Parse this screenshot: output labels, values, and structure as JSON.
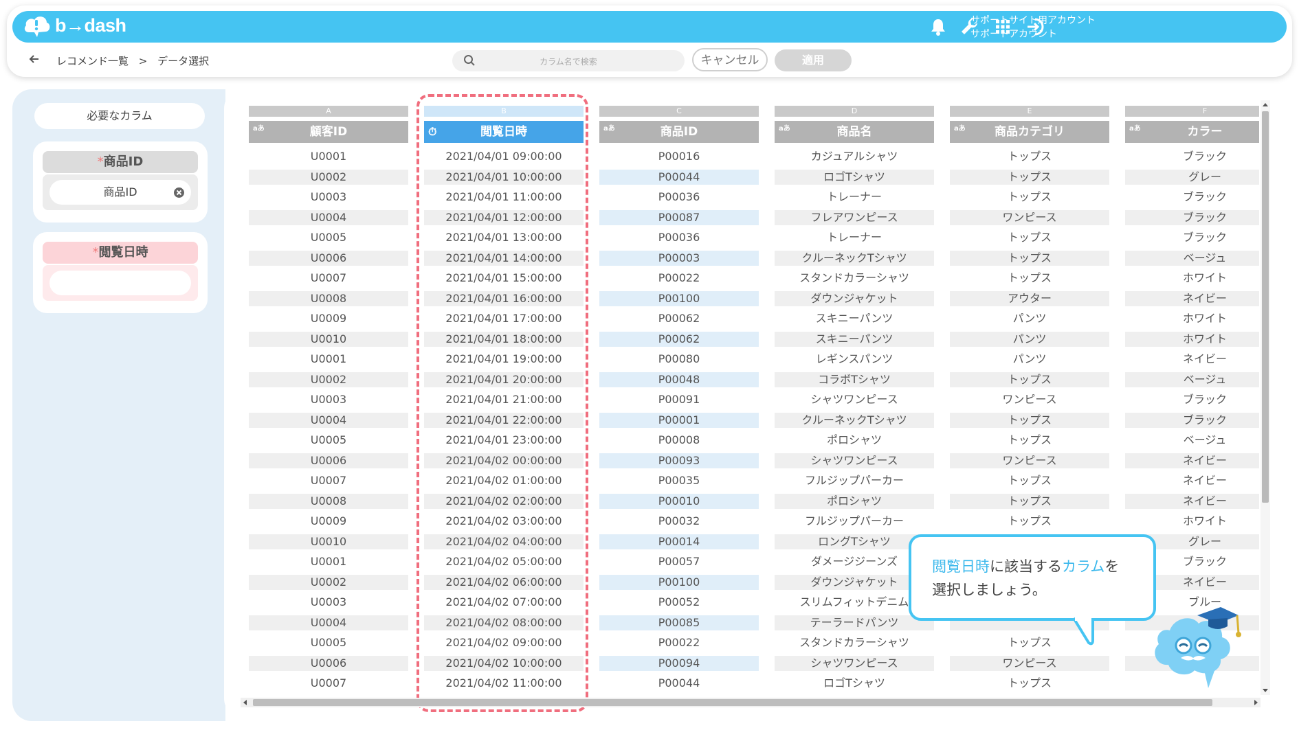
{
  "app": {
    "logo_text": "b→dash",
    "account_line1": "サポートサイト用アカウント",
    "account_line2": "サポートアカウント",
    "icons": [
      "bell-icon",
      "wrench-icon",
      "apps-grid-icon",
      "logout-icon"
    ],
    "accent_color": "#45c4f2"
  },
  "nav": {
    "back_icon": "arrow-left-icon",
    "breadcrumb": [
      "レコメンド一覧",
      ">",
      "データ選択"
    ]
  },
  "toolbar": {
    "search_placeholder": "カラム名で検索",
    "cancel_label": "キャンセル",
    "apply_label": "適用"
  },
  "sidebar": {
    "title": "必要なカラム",
    "slots": [
      {
        "required_mark": "*",
        "label": "商品ID",
        "value": "商品ID",
        "state": "filled"
      },
      {
        "required_mark": "*",
        "label": "閲覧日時",
        "value": "",
        "state": "empty"
      }
    ]
  },
  "columns": [
    {
      "letter": "A",
      "header": "顧客ID",
      "type": "text",
      "type_badge": "aあ",
      "selected": false,
      "stripe": "gray",
      "values": [
        "U0001",
        "U0002",
        "U0003",
        "U0004",
        "U0005",
        "U0006",
        "U0007",
        "U0008",
        "U0009",
        "U0010",
        "U0001",
        "U0002",
        "U0003",
        "U0004",
        "U0005",
        "U0006",
        "U0007",
        "U0008",
        "U0009",
        "U0010",
        "U0001",
        "U0002",
        "U0003",
        "U0004",
        "U0005",
        "U0006",
        "U0007"
      ]
    },
    {
      "letter": "B",
      "header": "閲覧日時",
      "type": "datetime",
      "type_badge": "⏱",
      "selected": true,
      "stripe": "gray",
      "values": [
        "2021/04/01 09:00:00",
        "2021/04/01 10:00:00",
        "2021/04/01 11:00:00",
        "2021/04/01 12:00:00",
        "2021/04/01 13:00:00",
        "2021/04/01 14:00:00",
        "2021/04/01 15:00:00",
        "2021/04/01 16:00:00",
        "2021/04/01 17:00:00",
        "2021/04/01 18:00:00",
        "2021/04/01 19:00:00",
        "2021/04/01 20:00:00",
        "2021/04/01 21:00:00",
        "2021/04/01 22:00:00",
        "2021/04/01 23:00:00",
        "2021/04/02 00:00:00",
        "2021/04/02 01:00:00",
        "2021/04/02 02:00:00",
        "2021/04/02 03:00:00",
        "2021/04/02 04:00:00",
        "2021/04/02 05:00:00",
        "2021/04/02 06:00:00",
        "2021/04/02 07:00:00",
        "2021/04/02 08:00:00",
        "2021/04/02 09:00:00",
        "2021/04/02 10:00:00",
        "2021/04/02 11:00:00"
      ]
    },
    {
      "letter": "C",
      "header": "商品ID",
      "type": "text",
      "type_badge": "aあ",
      "selected": false,
      "stripe": "blue",
      "values": [
        "P00016",
        "P00044",
        "P00036",
        "P00087",
        "P00036",
        "P00003",
        "P00022",
        "P00100",
        "P00062",
        "P00062",
        "P00080",
        "P00048",
        "P00091",
        "P00001",
        "P00008",
        "P00093",
        "P00035",
        "P00010",
        "P00032",
        "P00014",
        "P00057",
        "P00100",
        "P00052",
        "P00085",
        "P00022",
        "P00094",
        "P00044"
      ]
    },
    {
      "letter": "D",
      "header": "商品名",
      "type": "text",
      "type_badge": "aあ",
      "selected": false,
      "stripe": "gray",
      "values": [
        "カジュアルシャツ",
        "ロゴTシャツ",
        "トレーナー",
        "フレアワンピース",
        "トレーナー",
        "クルーネックTシャツ",
        "スタンドカラーシャツ",
        "ダウンジャケット",
        "スキニーパンツ",
        "スキニーパンツ",
        "レギンスパンツ",
        "コラボTシャツ",
        "シャツワンピース",
        "クルーネックTシャツ",
        "ポロシャツ",
        "シャツワンピース",
        "フルジップパーカー",
        "ポロシャツ",
        "フルジップパーカー",
        "ロングTシャツ",
        "ダメージジーンズ",
        "ダウンジャケット",
        "スリムフィットデニム",
        "テーラードパンツ",
        "スタンドカラーシャツ",
        "シャツワンピース",
        "ロゴTシャツ"
      ]
    },
    {
      "letter": "E",
      "header": "商品カテゴリ",
      "type": "text",
      "type_badge": "aあ",
      "selected": false,
      "stripe": "gray",
      "values": [
        "トップス",
        "トップス",
        "トップス",
        "ワンピース",
        "トップス",
        "トップス",
        "トップス",
        "アウター",
        "パンツ",
        "パンツ",
        "パンツ",
        "トップス",
        "ワンピース",
        "トップス",
        "トップス",
        "ワンピース",
        "トップス",
        "トップス",
        "トップス",
        "",
        "",
        "",
        "",
        "",
        "トップス",
        "ワンピース",
        "トップス"
      ]
    },
    {
      "letter": "F",
      "header": "カラー",
      "type": "text",
      "type_badge": "aあ",
      "selected": false,
      "stripe": "gray",
      "values": [
        "ブラック",
        "グレー",
        "ブラック",
        "ブラック",
        "ブラック",
        "ベージュ",
        "ホワイト",
        "ネイビー",
        "ホワイト",
        "ホワイト",
        "ネイビー",
        "ベージュ",
        "ブラック",
        "ブラック",
        "ベージュ",
        "ネイビー",
        "ネイビー",
        "ネイビー",
        "ホワイト",
        "グレー",
        "ブラック",
        "ネイビー",
        "ブルー",
        "",
        "",
        "",
        ""
      ]
    }
  ],
  "tooltip": {
    "part1": "閲覧日時",
    "part2": "に該当する",
    "part3": "カラム",
    "part4": "を",
    "line2": "選択しましょう。"
  },
  "colors": {
    "header_gray": "#b3b3b3",
    "header_selected": "#45a4e8",
    "letter_gray": "#c9c9c9",
    "letter_selected": "#cfe6f8",
    "required_pink": "#fcd9dc",
    "selection_outline": "#f06e7e"
  }
}
